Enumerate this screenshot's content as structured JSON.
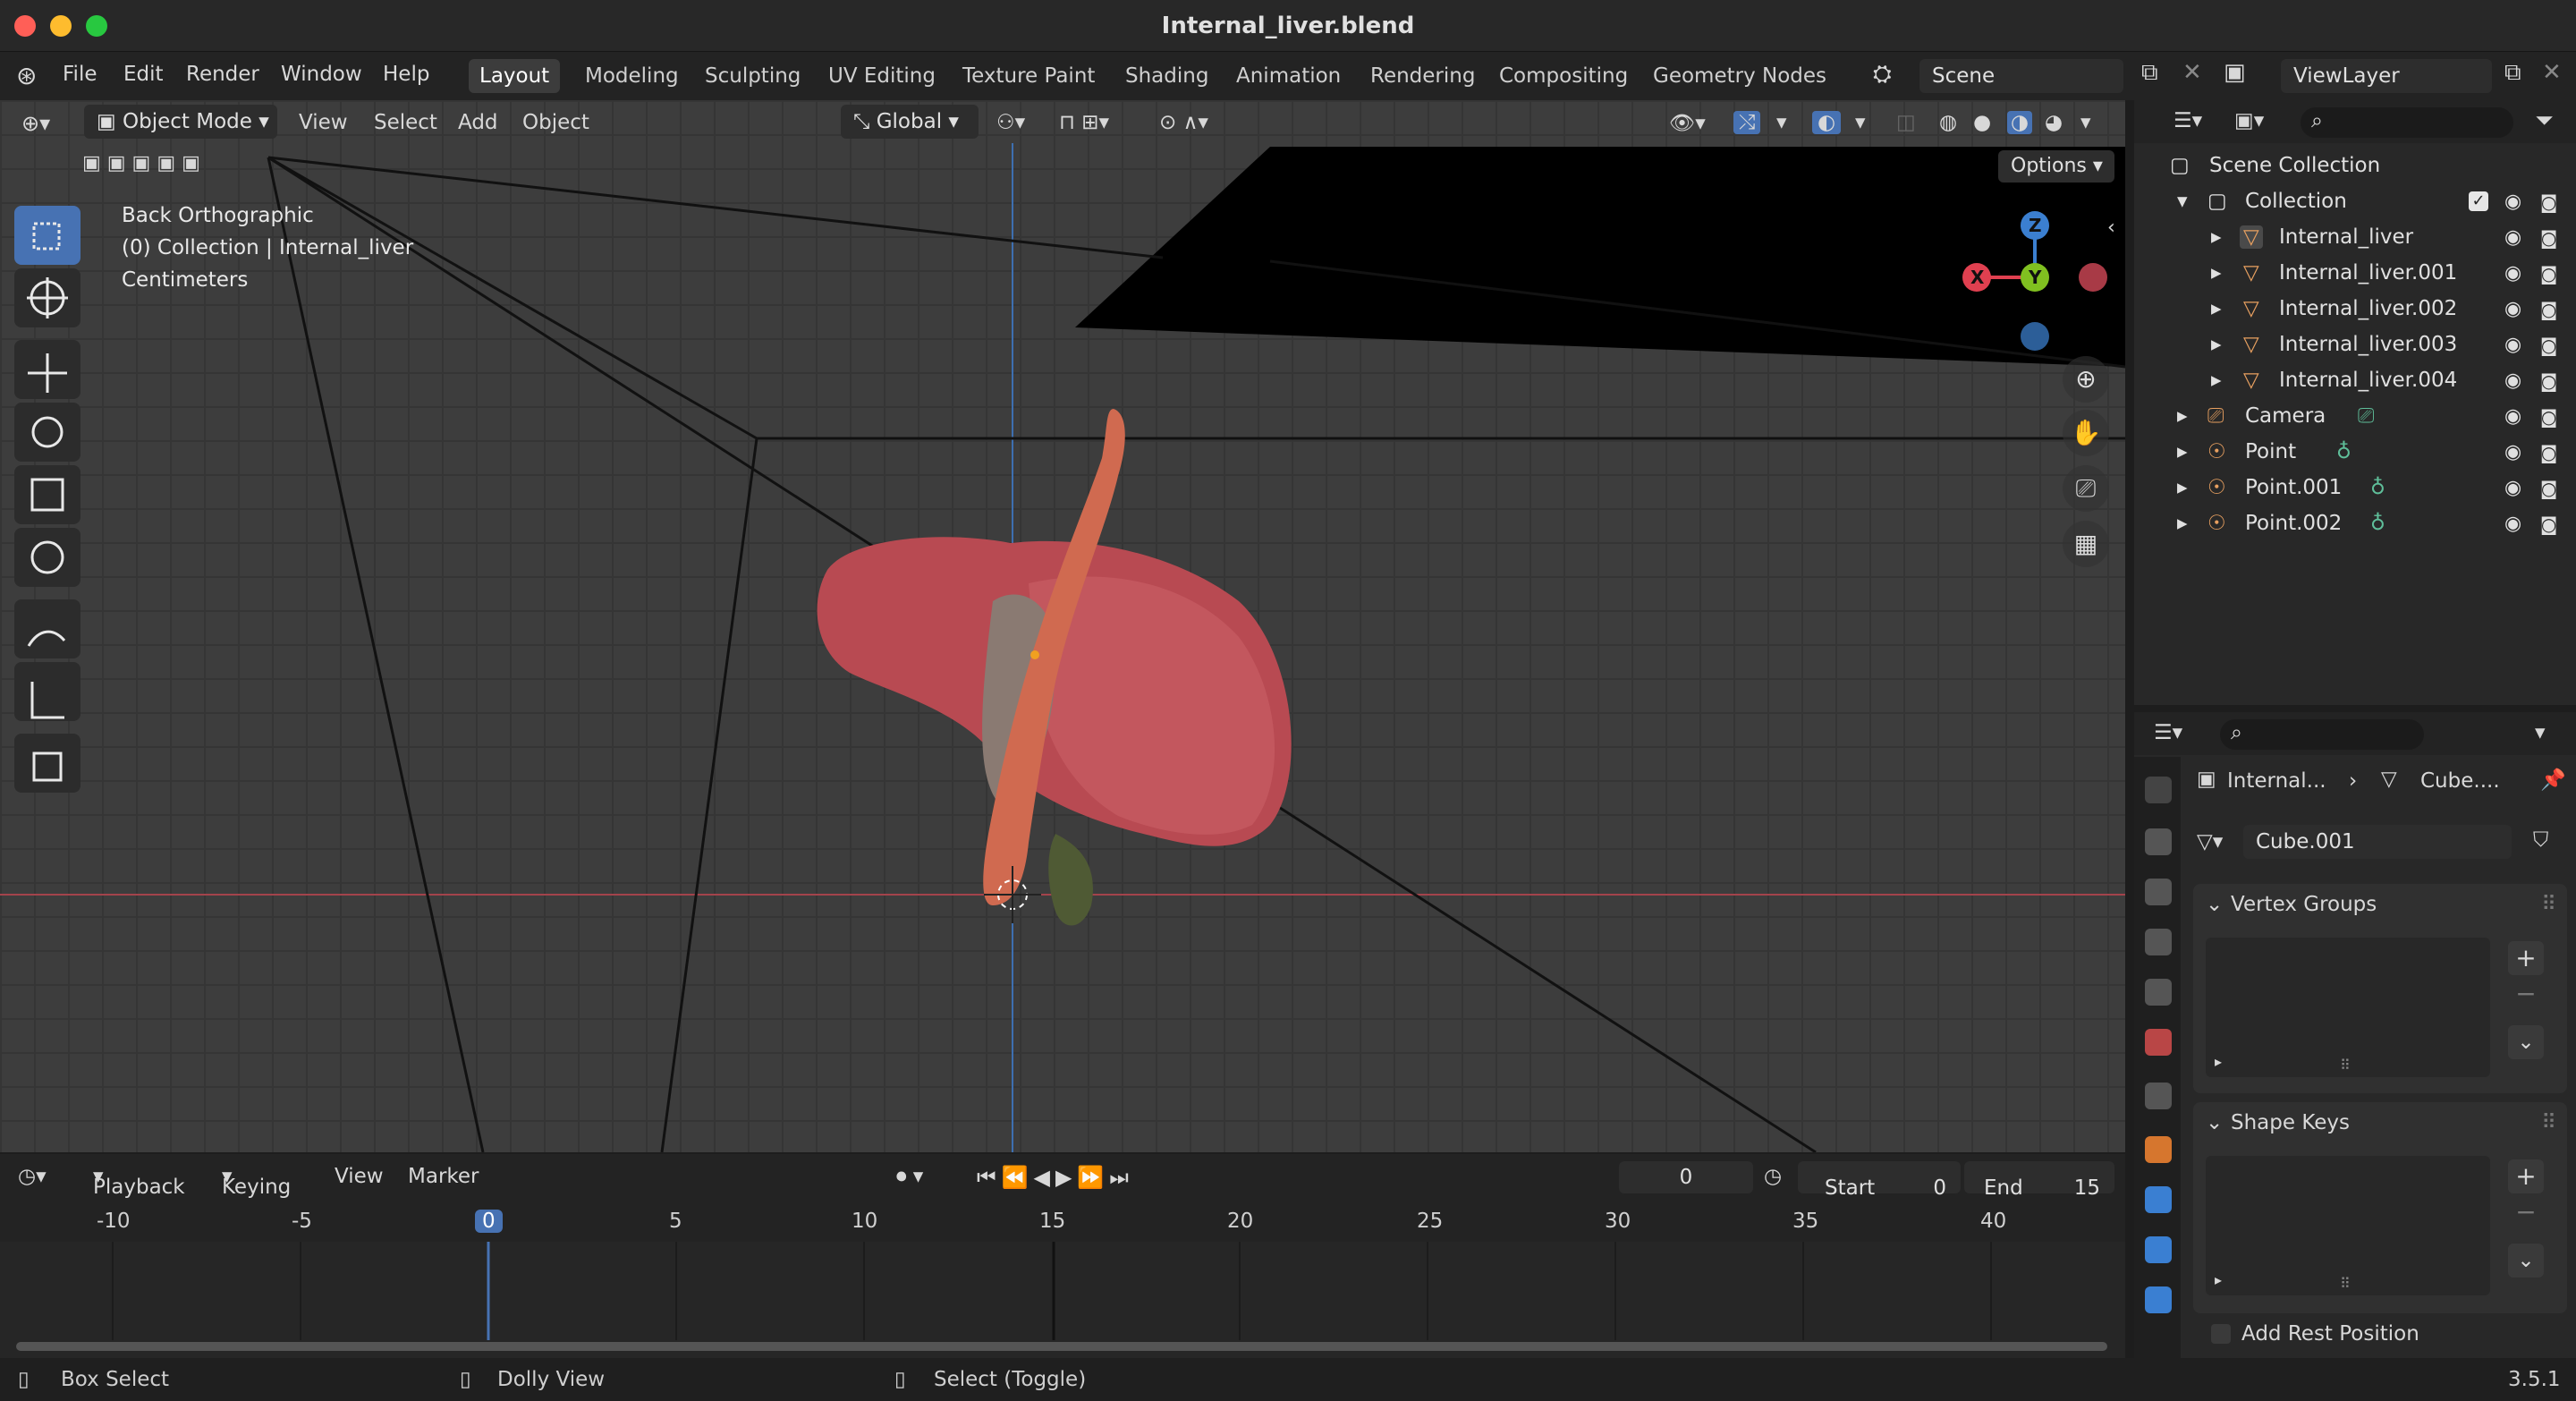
{
  "window": {
    "title": "Internal_liver.blend"
  },
  "menu": [
    "File",
    "Edit",
    "Render",
    "Window",
    "Help"
  ],
  "workspaces": [
    "Layout",
    "Modeling",
    "Sculpting",
    "UV Editing",
    "Texture Paint",
    "Shading",
    "Animation",
    "Rendering",
    "Compositing",
    "Geometry Nodes"
  ],
  "scene": {
    "label": "Scene",
    "view_layer": "ViewLayer"
  },
  "viewport": {
    "mode": "Object Mode",
    "menus": [
      "View",
      "Select",
      "Add",
      "Object"
    ],
    "orientation": "Global",
    "options": "Options",
    "info": {
      "view": "Back Orthographic",
      "collection": "(0) Collection | Internal_liver",
      "units": "Centimeters"
    },
    "gizmo": {
      "z": "Z",
      "y": "Y",
      "x": "X"
    }
  },
  "outliner": {
    "root": "Scene Collection",
    "collection": "Collection",
    "items": [
      "Internal_liver",
      "Internal_liver.001",
      "Internal_liver.002",
      "Internal_liver.003",
      "Internal_liver.004",
      "Camera",
      "Point",
      "Point.001",
      "Point.002"
    ]
  },
  "properties": {
    "breadcrumb_object": "Internal...",
    "breadcrumb_mesh": "Cube....",
    "mesh_name": "Cube.001",
    "vertex_groups": "Vertex Groups",
    "shape_keys": "Shape Keys",
    "add_rest_position": "Add Rest Position"
  },
  "timeline": {
    "menus": [
      "Playback",
      "Keying",
      "View",
      "Marker"
    ],
    "current_frame": "0",
    "start_label": "Start",
    "start": "0",
    "end_label": "End",
    "end": "15",
    "ticks": [
      "-10",
      "-5",
      "0",
      "5",
      "10",
      "15",
      "20",
      "25",
      "30",
      "35",
      "40"
    ]
  },
  "status": {
    "left": "Box Select",
    "middle": "Dolly View",
    "right": "Select (Toggle)",
    "version": "3.5.1"
  },
  "colors": {
    "accent": "#4772b3",
    "x_axis": "#e04050",
    "y_axis": "#80c020",
    "z_axis": "#3b7fd0",
    "liver": "#b84a52"
  }
}
